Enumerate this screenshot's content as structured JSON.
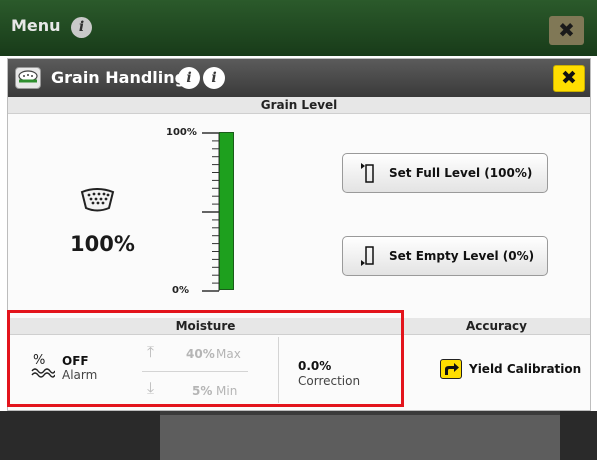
{
  "menu": {
    "title": "Menu",
    "info_icon": "info-icon",
    "close_icon": "close-icon",
    "close_glyph": "✖",
    "info_glyph": "i"
  },
  "dialog": {
    "title": "Grain Handling",
    "app_icon": "grain-handling-icon",
    "info_glyph": "i",
    "close_glyph": "✖",
    "accent_color": "#ffde00"
  },
  "grain_level": {
    "section_title": "Grain Level",
    "percent_display": "100%",
    "scale_top_label": "100%",
    "scale_bottom_label": "0%",
    "fill_level": 1.0,
    "fill_color": "#1ea01e",
    "set_full_label": "Set Full Level (100%)",
    "set_empty_label": "Set Empty Level (0%)"
  },
  "moisture": {
    "section_title": "Moisture",
    "alarm_state": "OFF",
    "alarm_label": "Alarm",
    "max_value": "40%",
    "max_label": "Max",
    "min_value": "5%",
    "min_label": "Min",
    "correction_value": "0.0%",
    "correction_label": "Correction"
  },
  "accuracy": {
    "section_title": "Accuracy",
    "yield_calibration_label": "Yield Calibration"
  },
  "highlight_color": "#e3141c"
}
